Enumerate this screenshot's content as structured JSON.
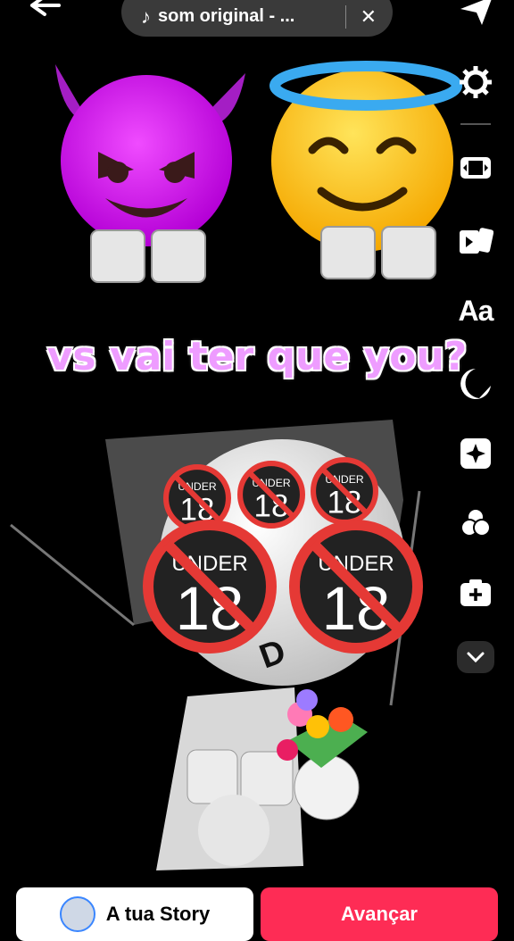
{
  "sound": {
    "label": "som original - ...",
    "note_icon": "music-note-icon",
    "close_icon": "close-icon"
  },
  "caption": "vs vai ter que you?",
  "toolbar": {
    "text_tool_label": "Aa",
    "icons": [
      "settings-icon",
      "aspect-ratio-icon",
      "templates-icon",
      "text-icon",
      "stickers-icon",
      "effects-icon",
      "filters-icon",
      "add-camera-icon",
      "chevron-down-icon"
    ]
  },
  "stickers": {
    "under18_label": "UNDER",
    "under18_number": "18"
  },
  "face_text": "D",
  "bottom": {
    "story_label": "A tua Story",
    "next_label": "Avançar"
  },
  "colors": {
    "accent": "#fe2c55",
    "caption": "#ee9cff"
  }
}
